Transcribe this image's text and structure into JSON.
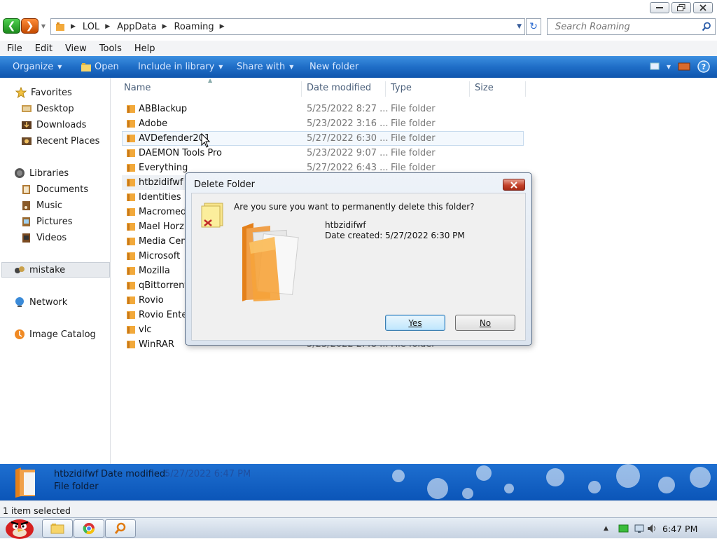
{
  "window": {
    "minimize_icon": "minimize-icon",
    "restore_icon": "restore-icon",
    "close_icon": "close-icon"
  },
  "address": {
    "breadcrumbs": [
      "LOL",
      "AppData",
      "Roaming"
    ],
    "search_placeholder": "Search Roaming"
  },
  "menu": [
    "File",
    "Edit",
    "View",
    "Tools",
    "Help"
  ],
  "toolbar": {
    "organize": "Organize",
    "open": "Open",
    "include": "Include in library",
    "share": "Share with",
    "new_folder": "New folder"
  },
  "nav": {
    "favorites": "Favorites",
    "desktop": "Desktop",
    "downloads": "Downloads",
    "recent": "Recent Places",
    "libraries": "Libraries",
    "documents": "Documents",
    "music": "Music",
    "pictures": "Pictures",
    "videos": "Videos",
    "homegroup": "mistake",
    "network": "Network",
    "image_catalog": "Image Catalog"
  },
  "columns": {
    "name": "Name",
    "date": "Date modified",
    "type": "Type",
    "size": "Size"
  },
  "files": [
    {
      "name": "ABBlackup",
      "date": "5/25/2022 8:27 ...",
      "type": "File folder"
    },
    {
      "name": "Adobe",
      "date": "5/23/2022 3:16 ...",
      "type": "File folder"
    },
    {
      "name": "AVDefender2011",
      "date": "5/27/2022 6:30 ...",
      "type": "File folder"
    },
    {
      "name": "DAEMON Tools Pro",
      "date": "5/23/2022 9:07 ...",
      "type": "File folder"
    },
    {
      "name": "Everything",
      "date": "5/27/2022 6:43 ...",
      "type": "File folder"
    },
    {
      "name": "htbzidifwf",
      "date": "",
      "type": ""
    },
    {
      "name": "Identities",
      "date": "",
      "type": ""
    },
    {
      "name": "Macromedia",
      "date": "",
      "type": ""
    },
    {
      "name": "Mael Horz",
      "date": "",
      "type": ""
    },
    {
      "name": "Media Center",
      "date": "",
      "type": ""
    },
    {
      "name": "Microsoft",
      "date": "",
      "type": ""
    },
    {
      "name": "Mozilla",
      "date": "",
      "type": ""
    },
    {
      "name": "qBittorrent",
      "date": "",
      "type": ""
    },
    {
      "name": "Rovio",
      "date": "",
      "type": ""
    },
    {
      "name": "Rovio Entertainment",
      "date": "",
      "type": ""
    },
    {
      "name": "vlc",
      "date": "",
      "type": ""
    },
    {
      "name": "WinRAR",
      "date": "5/23/2022 2:48 ...",
      "type": "File folder"
    }
  ],
  "dialog": {
    "title": "Delete Folder",
    "question": "Are you sure you want to permanently delete this folder?",
    "folder_name": "htbzidifwf",
    "date_created": "Date created: 5/27/2022 6:30 PM",
    "yes": "Yes",
    "no": "No"
  },
  "details": {
    "name": "htbzidifwf",
    "label": "Date modified:",
    "date": "5/27/2022 6:47 PM",
    "type": "File folder"
  },
  "status": "1 item selected",
  "taskbar": {
    "clock": "6:47 PM"
  },
  "colors": {
    "toolbar": "#1f6ec7",
    "details": "#0b55b8",
    "folder": "#f2a93b"
  }
}
